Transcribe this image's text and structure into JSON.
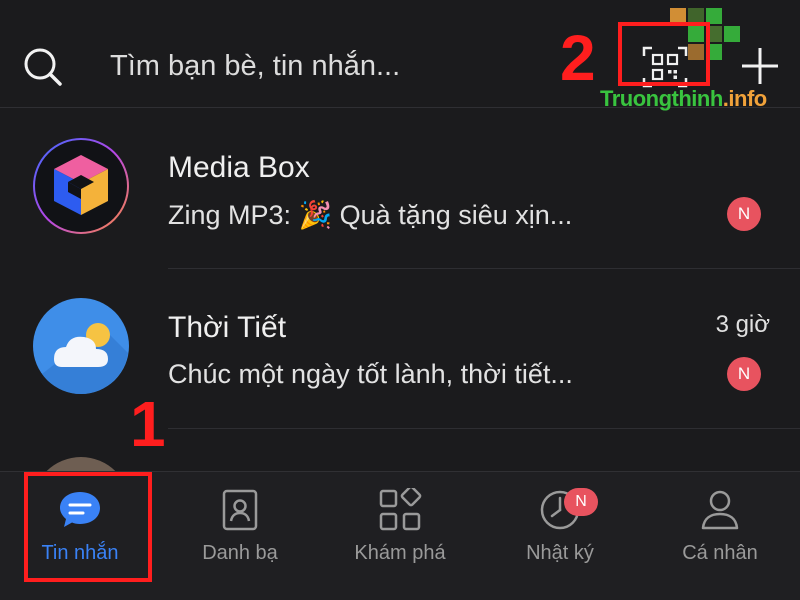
{
  "header": {
    "search_placeholder": "Tìm bạn bè, tin nhắn...",
    "qr_icon": "qr-scan-icon",
    "plus_icon": "plus-icon"
  },
  "annotations": {
    "label_1": "1",
    "label_2": "2",
    "color": "#ff1e1e"
  },
  "watermark": {
    "main": "Truongthinh",
    "suffix": ".info"
  },
  "chats": [
    {
      "name": "Media Box",
      "preview": "Zing MP3: 🎉 Quà tặng siêu xịn...",
      "time": "",
      "badge": "N",
      "avatar_icon": "media-box-cube-icon"
    },
    {
      "name": "Thời Tiết",
      "preview": "Chúc một ngày tốt lành, thời tiết...",
      "time": "3 giờ",
      "badge": "N",
      "avatar_icon": "weather-cloud-sun-icon"
    }
  ],
  "tabs": [
    {
      "label": "Tin nhắn",
      "icon": "chat-bubble-icon",
      "active": true
    },
    {
      "label": "Danh bạ",
      "icon": "contacts-icon",
      "active": false
    },
    {
      "label": "Khám phá",
      "icon": "discover-grid-icon",
      "active": false
    },
    {
      "label": "Nhật ký",
      "icon": "clock-icon",
      "active": false,
      "badge": "N"
    },
    {
      "label": "Cá nhân",
      "icon": "person-icon",
      "active": false
    }
  ],
  "colors": {
    "background": "#1b1b1d",
    "accent_blue": "#3a82f6",
    "badge_red": "#e8535f",
    "tab_inactive": "#9a9a9a"
  }
}
